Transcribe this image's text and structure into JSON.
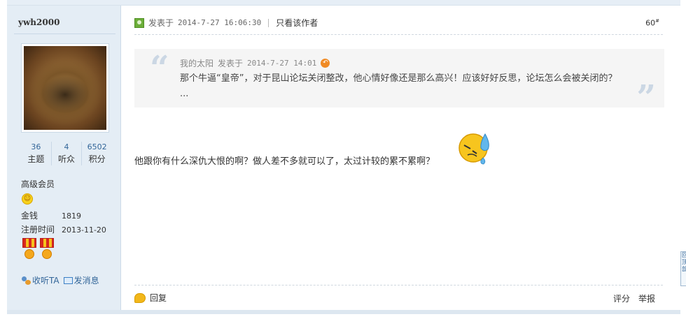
{
  "author": {
    "username": "ywh2000",
    "stats": [
      {
        "value": "36",
        "label": "主题"
      },
      {
        "value": "4",
        "label": "听众"
      },
      {
        "value": "6502",
        "label": "积分"
      }
    ],
    "group": "高级会员",
    "group_icon": "smiley-rank-icon",
    "money_label": "金钱",
    "money_value": "1819",
    "reg_label": "注册时间",
    "reg_value": "2013-11-20",
    "follow_label": "收听TA",
    "message_label": "发消息"
  },
  "post": {
    "posted_label": "发表于",
    "posted_time": "2014-7-27 16:06:30",
    "only_author": "只看该作者",
    "floor": "60",
    "floor_mark": "#",
    "quote": {
      "author": "我的太阳",
      "posted_label": "发表于",
      "time": "2014-7-27 14:01",
      "text": "那个牛逼“皇帝”，对于昆山论坛关闭整改，他心情好像还是那么高兴！应该好好反思，论坛怎么会被关闭的？ ..."
    },
    "message": "他跟你有什么深仇大恨的啊？做人差不多就可以了，太过计较的累不累啊？",
    "emoji": "sweat-smiley-icon"
  },
  "footer": {
    "reply": "回复",
    "rate": "评分",
    "report": "举报"
  },
  "side_tab": "回顶部"
}
